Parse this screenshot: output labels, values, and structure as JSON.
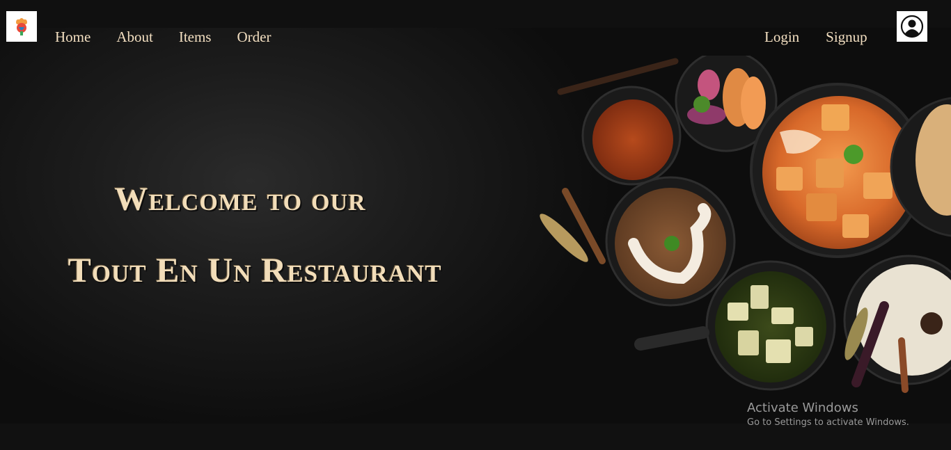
{
  "nav": {
    "left": [
      "Home",
      "About",
      "Items",
      "Order"
    ],
    "right": [
      "Login",
      "Signup"
    ]
  },
  "hero": {
    "line1": "Welcome to our",
    "line2": "Tout En Un Restaurant"
  },
  "icons": {
    "logo": "chef-logo-icon",
    "profile": "user-avatar-icon"
  },
  "watermark": {
    "title": "Activate Windows",
    "subtitle": "Go to Settings to activate Windows."
  },
  "colors": {
    "accent": "#f3dfc1",
    "background": "#0f0f0f"
  }
}
